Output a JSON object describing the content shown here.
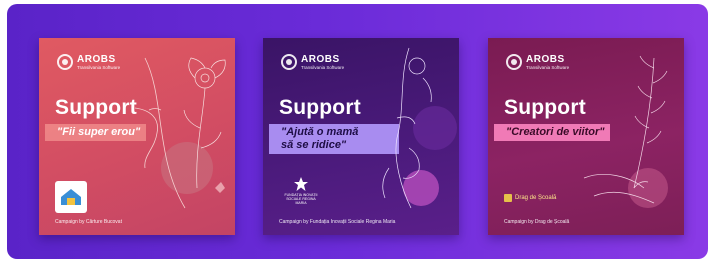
{
  "brand": {
    "name": "AROBS",
    "tagline": "Transilvania Software"
  },
  "cards": [
    {
      "support": "Support",
      "quote_lines": [
        "\"Fii super erou\""
      ],
      "footer": "Campaign by Cărture Bucovat",
      "partner": "Cărture Bucovat"
    },
    {
      "support": "Support",
      "quote_lines": [
        "\"Ajută o mamă",
        "să se ridice\""
      ],
      "footer": "Campaign by Fundația Inovații Sociale Regina Maria",
      "partner": "FUNDAȚIA INOVAȚII SOCIALE REGINA MARIA"
    },
    {
      "support": "Support",
      "quote_lines": [
        "\"Creatori de viitor\""
      ],
      "footer": "Campaign by Drag de Școală",
      "partner": "Drag de Școală"
    }
  ]
}
